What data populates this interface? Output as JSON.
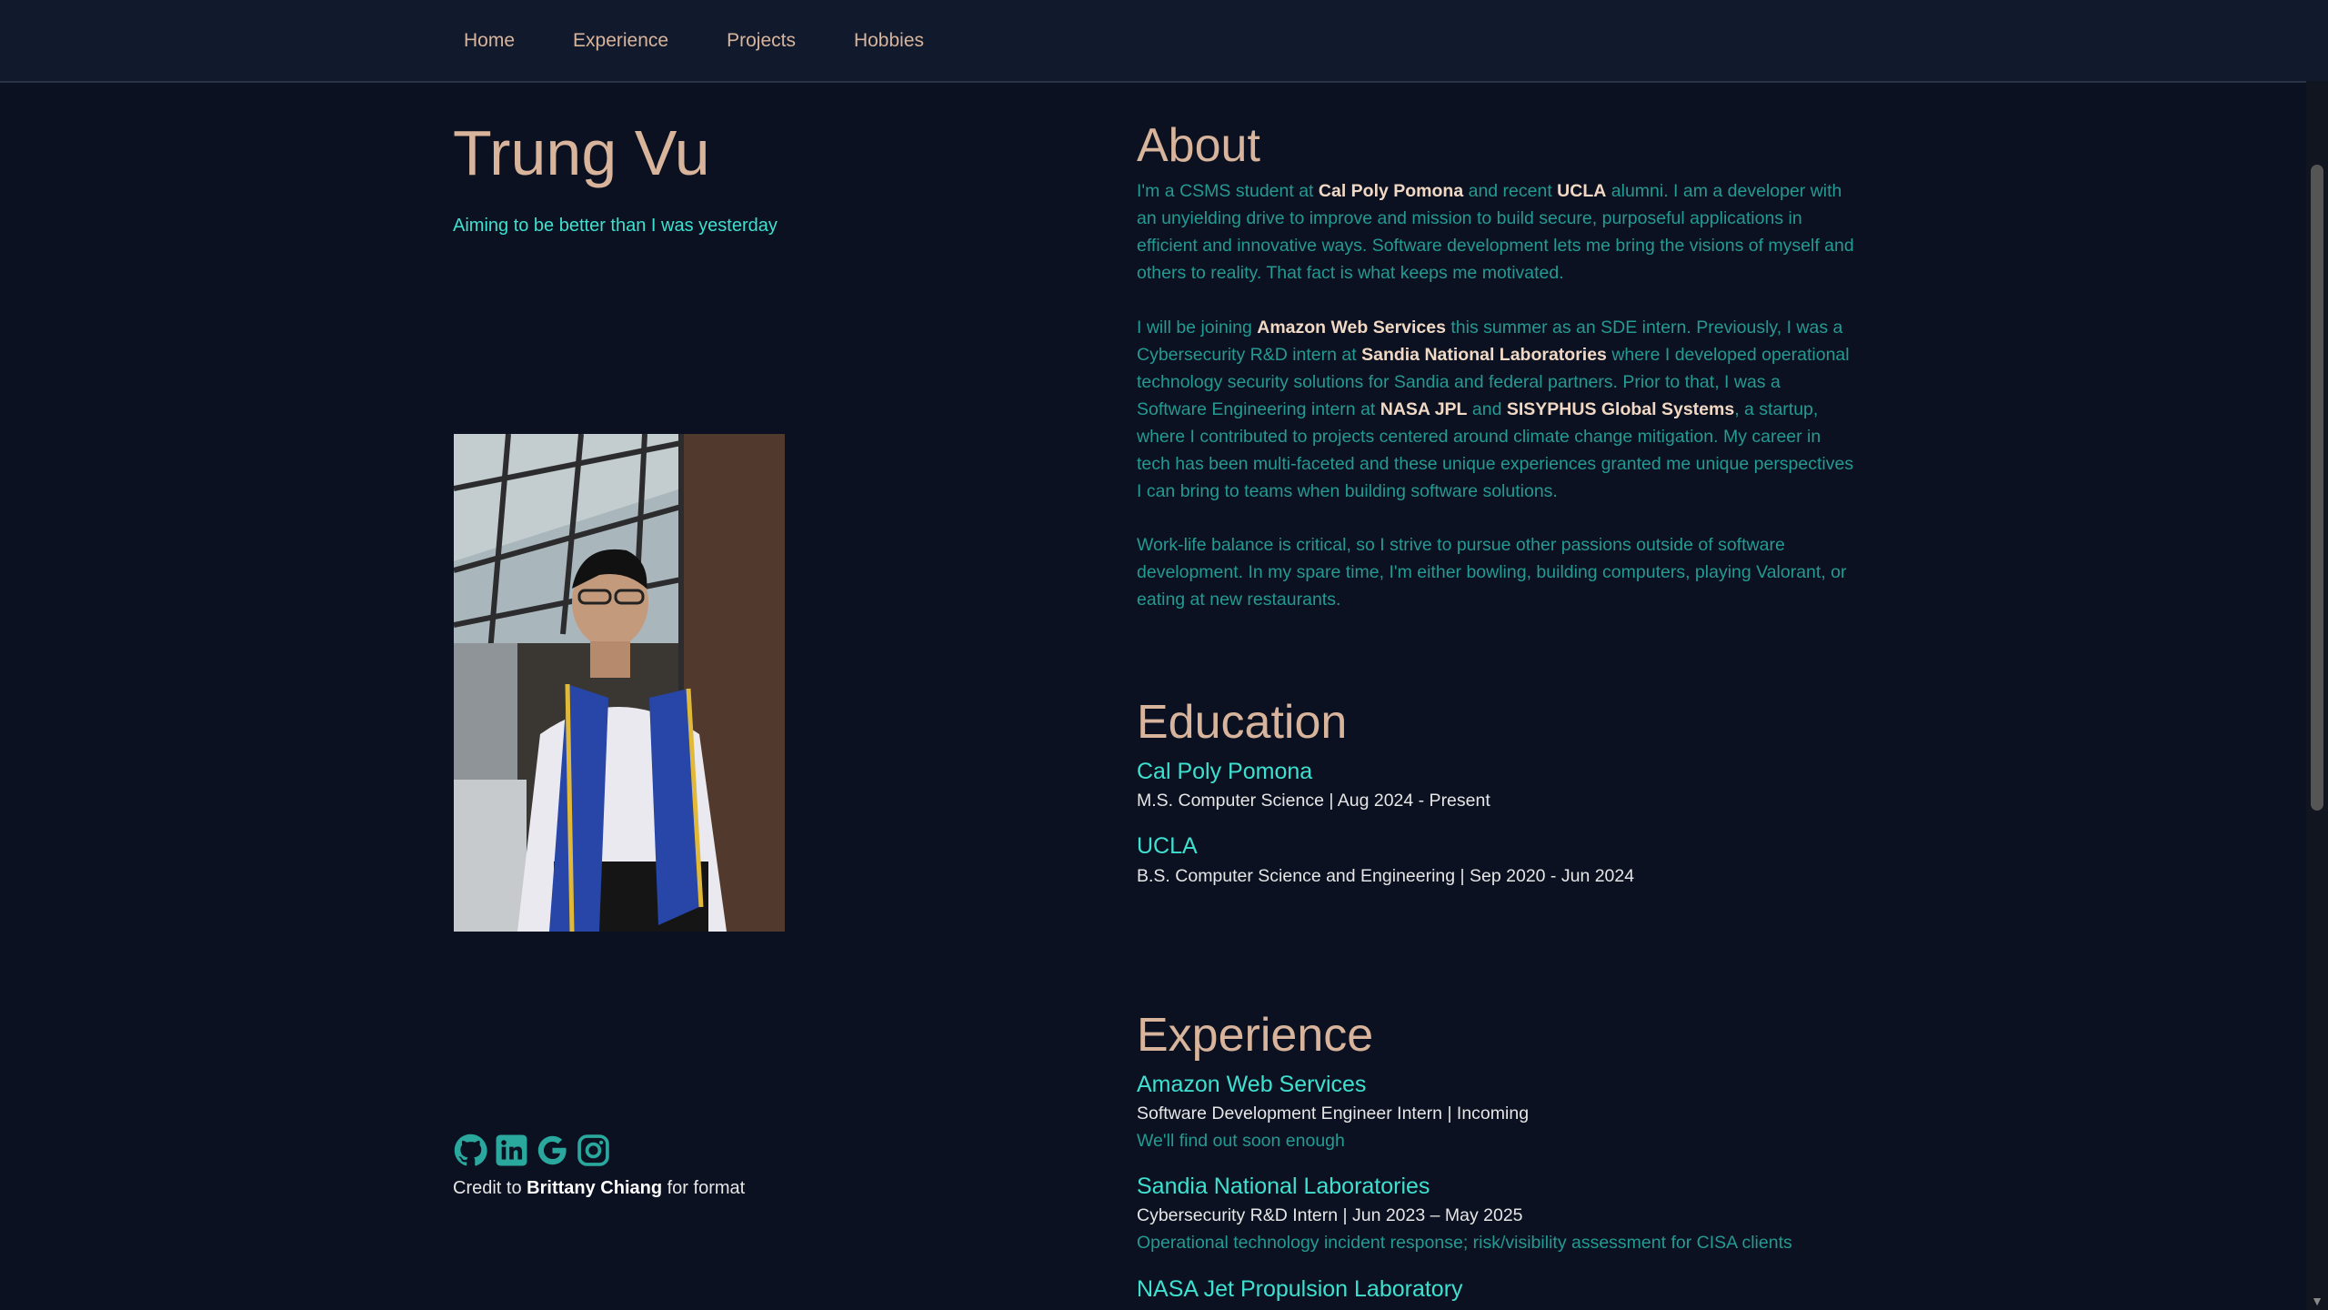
{
  "nav": {
    "items": [
      "Home",
      "Experience",
      "Projects",
      "Hobbies"
    ]
  },
  "profile": {
    "name": "Trung Vu",
    "tagline": "Aiming to be better than I was yesterday",
    "social_icons": [
      "github-icon",
      "linkedin-icon",
      "google-icon",
      "instagram-icon"
    ],
    "credit_prefix": "Credit to ",
    "credit_name": "Brittany Chiang",
    "credit_suffix": " for format"
  },
  "about": {
    "title": "About",
    "p1": [
      {
        "t": "I'm a CSMS student at "
      },
      {
        "t": "Cal Poly Pomona",
        "b": true
      },
      {
        "t": " and recent "
      },
      {
        "t": "UCLA",
        "b": true
      },
      {
        "t": " alumni. I am a developer with an unyielding drive to improve and mission to build secure, purposeful applications in efficient and innovative ways. Software development lets me bring the visions of myself and others to reality. That fact is what keeps me motivated."
      }
    ],
    "p2": [
      {
        "t": "I will be joining "
      },
      {
        "t": "Amazon Web Services",
        "b": true
      },
      {
        "t": " this summer as an SDE intern. Previously, I was a Cybersecurity R&D intern at "
      },
      {
        "t": "Sandia National Laboratories",
        "b": true
      },
      {
        "t": " where I developed operational technology security solutions for Sandia and federal partners. Prior to that, I was a Software Engineering intern at "
      },
      {
        "t": "NASA JPL",
        "b": true
      },
      {
        "t": " and "
      },
      {
        "t": "SISYPHUS Global Systems",
        "b": true
      },
      {
        "t": ", a startup, where I contributed to projects centered around climate change mitigation. My career in tech has been multi-faceted and these unique experiences granted me unique perspectives I can bring to teams when building software solutions."
      }
    ],
    "p3": [
      {
        "t": "Work-life balance is critical, so I strive to pursue other passions outside of software development. In my spare time, I'm either bowling, building computers, playing Valorant, or eating at new restaurants."
      }
    ]
  },
  "education": {
    "title": "Education",
    "items": [
      {
        "school": "Cal Poly Pomona",
        "detail": "M.S. Computer Science | Aug 2024 - Present"
      },
      {
        "school": "UCLA",
        "detail": "B.S. Computer Science and Engineering | Sep 2020 - Jun 2024"
      }
    ]
  },
  "experience": {
    "title": "Experience",
    "items": [
      {
        "org": "Amazon Web Services",
        "role": "Software Development Engineer Intern | Incoming",
        "desc": "We'll find out soon enough"
      },
      {
        "org": "Sandia National Laboratories",
        "role": "Cybersecurity R&D Intern | Jun 2023 – May 2025",
        "desc": "Operational technology incident response; risk/visibility assessment for CISA clients"
      },
      {
        "org": "NASA Jet Propulsion Laboratory",
        "role": "",
        "desc": ""
      }
    ]
  },
  "colors": {
    "background": "#0b1120",
    "navbar": "#111a2d",
    "heading": "#d7b49b",
    "accent": "#3ee0d0",
    "body_text": "#259a93"
  }
}
